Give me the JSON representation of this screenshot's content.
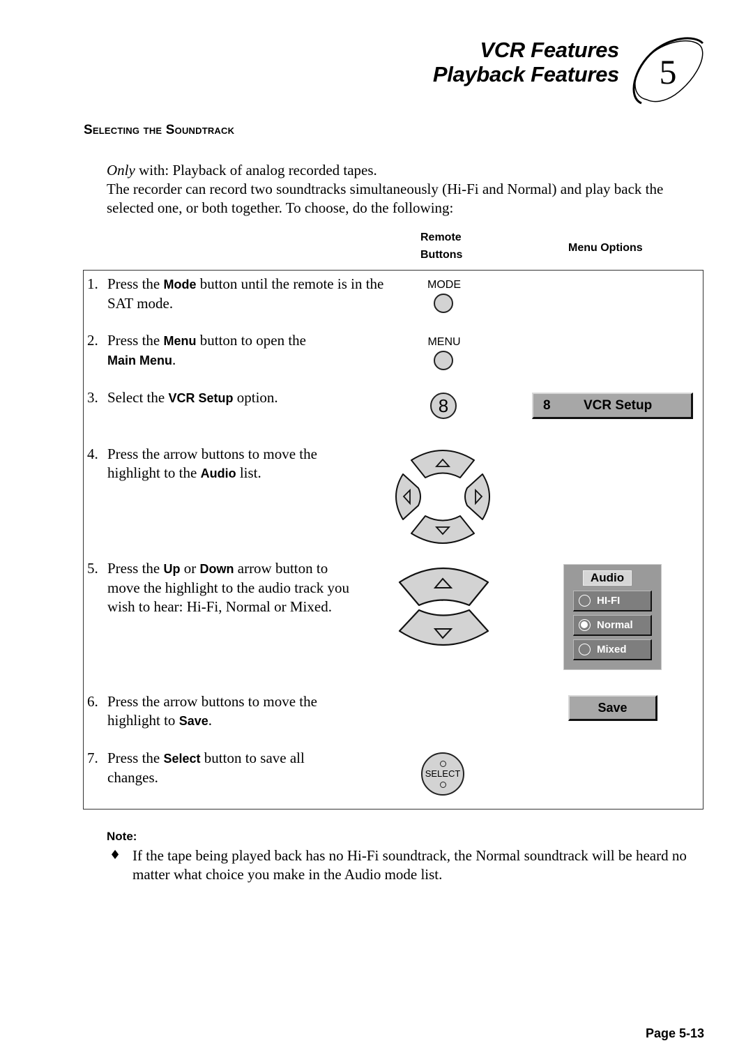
{
  "header": {
    "title_line1": "VCR Features",
    "title_line2": "Playback Features",
    "chapter_number": "5"
  },
  "section": {
    "title": "Selecting the Soundtrack"
  },
  "intro": {
    "only_word": "Only",
    "line1_rest": " with: Playback of analog recorded tapes.",
    "line2": "The recorder can record two soundtracks simultaneously (Hi-Fi and Normal) and play back the selected one, or both together. To choose, do the following:"
  },
  "table": {
    "col_remote_line1": "Remote",
    "col_remote_line2": "Buttons",
    "col_menu": "Menu Options",
    "steps": [
      {
        "num": "1.",
        "pre": "Press the ",
        "bold": "Mode",
        "post": " button until the remote is in the SAT mode."
      },
      {
        "num": "2.",
        "pre": "Press the ",
        "bold": "Menu",
        "post": " button to open the ",
        "bold2": "Main Menu",
        "post2": "."
      },
      {
        "num": "3.",
        "pre": "Select the ",
        "bold": "VCR Setup",
        "post": " option."
      },
      {
        "num": "4.",
        "pre": "Press the arrow buttons to move the highlight to the ",
        "bold": "Audio",
        "post": " list."
      },
      {
        "num": "5.",
        "pre": "Press the ",
        "bold": "Up",
        "mid": " or ",
        "bold2": "Down",
        "post": " arrow button to move the highlight to the audio track you wish to hear: Hi-Fi, Normal or Mixed."
      },
      {
        "num": "6.",
        "pre": "Press the arrow buttons to move the highlight to ",
        "bold": "Save",
        "post": "."
      },
      {
        "num": "7.",
        "pre": "Press the ",
        "bold": "Select",
        "post": " button to save all changes."
      }
    ],
    "remote": {
      "mode_label": "MODE",
      "menu_label": "MENU",
      "digit_label": "8",
      "select_label": "SELECT"
    },
    "menu": {
      "vcr_setup_number": "8",
      "vcr_setup_label": "VCR Setup",
      "audio_title": "Audio",
      "audio_options": [
        {
          "label": "HI-FI",
          "selected": false
        },
        {
          "label": "Normal",
          "selected": true
        },
        {
          "label": "Mixed",
          "selected": false
        }
      ],
      "save_label": "Save"
    }
  },
  "note": {
    "label": "Note:",
    "bullet": "♦",
    "text": "If the tape being played back has no Hi-Fi soundtrack, the Normal soundtrack will be heard no matter what choice you make in the Audio mode list."
  },
  "footer": {
    "page": "Page 5-13"
  }
}
